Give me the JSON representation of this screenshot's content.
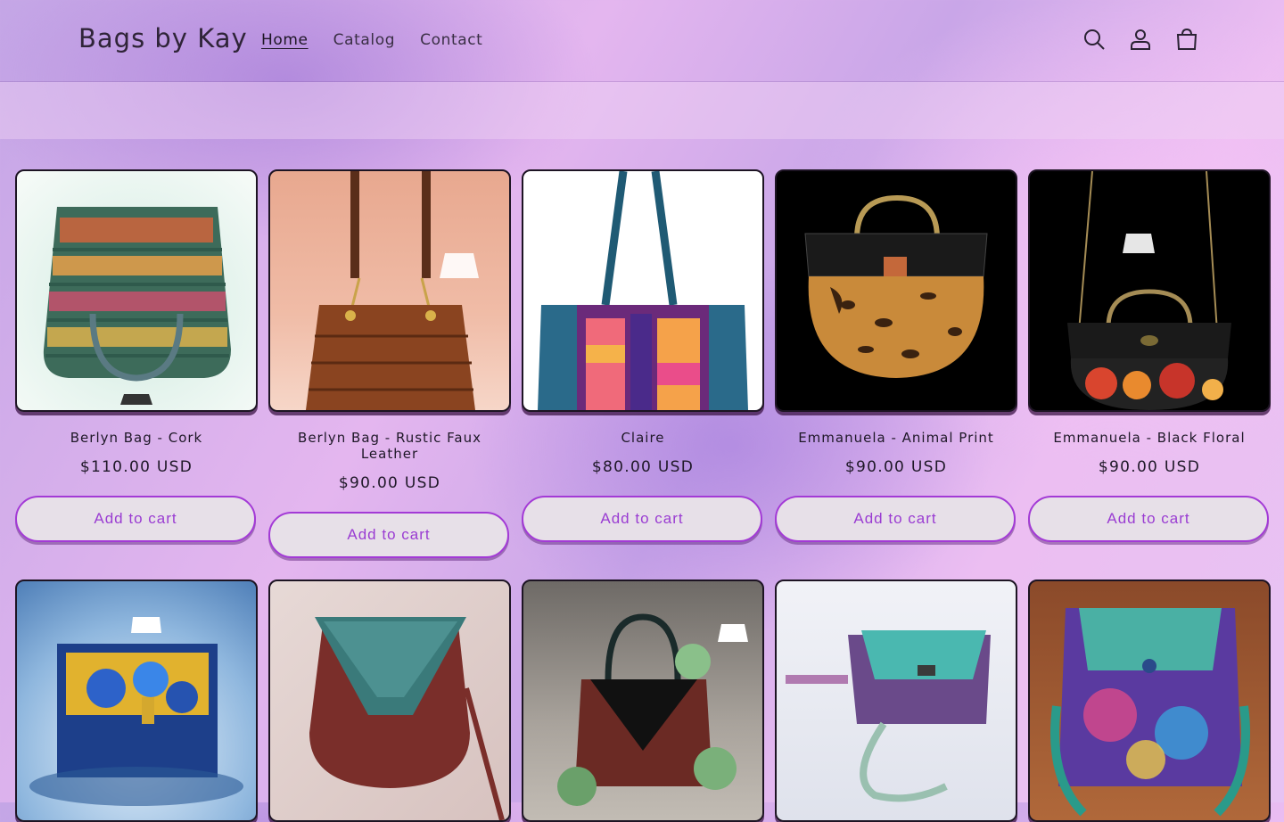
{
  "header": {
    "logo": "Bags by Kay",
    "nav": [
      {
        "label": "Home",
        "active": true
      },
      {
        "label": "Catalog",
        "active": false
      },
      {
        "label": "Contact",
        "active": false
      }
    ],
    "icons": [
      "search-icon",
      "account-icon",
      "cart-icon"
    ]
  },
  "products": [
    {
      "title": "Berlyn Bag - Cork",
      "price": "$110.00 USD",
      "cta": "Add to cart"
    },
    {
      "title": "Berlyn Bag - Rustic Faux Leather",
      "price": "$90.00 USD",
      "cta": "Add to cart"
    },
    {
      "title": "Claire",
      "price": "$80.00 USD",
      "cta": "Add to cart"
    },
    {
      "title": "Emmanuela - Animal Print",
      "price": "$90.00 USD",
      "cta": "Add to cart"
    },
    {
      "title": "Emmanuela - Black Floral",
      "price": "$90.00 USD",
      "cta": "Add to cart"
    }
  ],
  "colors": {
    "accent": "#a33ad6",
    "button_bg": "#e7e0e8",
    "card_border": "#1d1423"
  }
}
